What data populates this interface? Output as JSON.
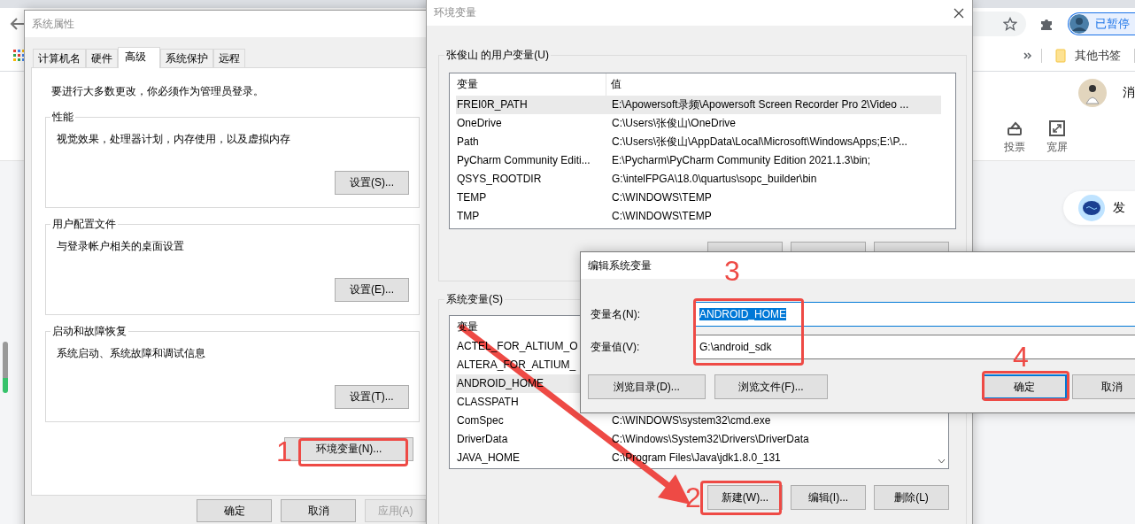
{
  "browser": {
    "profile_chip": "已暂停",
    "bookmark_folder": "其他书签",
    "user_menu": "消",
    "toolbar_actions": [
      {
        "label": "投票",
        "kind": "vote"
      },
      {
        "label": "宽屏",
        "kind": "widescreen"
      }
    ],
    "post_button": "发"
  },
  "system_properties": {
    "title": "系统属性",
    "tabs": [
      {
        "label": "计算机名",
        "selected": false
      },
      {
        "label": "硬件",
        "selected": false
      },
      {
        "label": "高级",
        "selected": true
      },
      {
        "label": "系统保护",
        "selected": false
      },
      {
        "label": "远程",
        "selected": false
      }
    ],
    "notice": "要进行大多数更改，你必须作为管理员登录。",
    "groups": [
      {
        "title": "性能",
        "description": "视觉效果，处理器计划，内存使用，以及虚拟内存",
        "button": "设置(S)..."
      },
      {
        "title": "用户配置文件",
        "description": "与登录帐户相关的桌面设置",
        "button": "设置(E)..."
      },
      {
        "title": "启动和故障恢复",
        "description": "系统启动、系统故障和调试信息",
        "button": "设置(T)..."
      }
    ],
    "env_button": "环境变量(N)...",
    "footer_buttons": [
      {
        "label": "确定",
        "disabled": false
      },
      {
        "label": "取消",
        "disabled": false
      },
      {
        "label": "应用(A)",
        "disabled": true
      }
    ]
  },
  "environment_variables": {
    "title": "环境变量",
    "user_group": {
      "title": "张俊山 的用户变量(U)",
      "columns": [
        "变量",
        "值"
      ],
      "rows": [
        {
          "name": "FREI0R_PATH",
          "value": "E:\\Apowersoft录频\\Apowersoft Screen Recorder Pro 2\\Video ...",
          "selected": true
        },
        {
          "name": "OneDrive",
          "value": "C:\\Users\\张俊山\\OneDrive",
          "selected": false
        },
        {
          "name": "Path",
          "value": "C:\\Users\\张俊山\\AppData\\Local\\Microsoft\\WindowsApps;E:\\P...",
          "selected": false
        },
        {
          "name": "PyCharm Community Editi...",
          "value": "E:\\Pycharm\\PyCharm Community Edition 2021.1.3\\bin;",
          "selected": false
        },
        {
          "name": "QSYS_ROOTDIR",
          "value": "G:\\intelFPGA\\18.0\\quartus\\sopc_builder\\bin",
          "selected": false
        },
        {
          "name": "TEMP",
          "value": "C:\\WINDOWS\\TEMP",
          "selected": false
        },
        {
          "name": "TMP",
          "value": "C:\\WINDOWS\\TEMP",
          "selected": false
        }
      ]
    },
    "system_group": {
      "title": "系统变量(S)",
      "columns": [
        "变量"
      ],
      "rows": [
        {
          "name": "ACTEL_FOR_ALTIUM_O",
          "selected": false
        },
        {
          "name": "ALTERA_FOR_ALTIUM_",
          "selected": false
        },
        {
          "name": "ANDROID_HOME",
          "selected": true
        },
        {
          "name": "CLASSPATH",
          "selected": false
        },
        {
          "name": "ComSpec",
          "value": "C:\\WINDOWS\\system32\\cmd.exe",
          "selected": false
        },
        {
          "name": "DriverData",
          "value": "C:\\Windows\\System32\\Drivers\\DriverData",
          "selected": false
        },
        {
          "name": "JAVA_HOME",
          "value": "C:\\Program Files\\Java\\jdk1.8.0_131",
          "selected": false
        }
      ],
      "buttons": [
        "新建(W)...",
        "编辑(I)...",
        "删除(L)"
      ]
    }
  },
  "edit_dialog": {
    "title": "编辑系统变量",
    "fields": [
      {
        "label": "变量名(N):",
        "value": "ANDROID_HOME",
        "text_selected": true
      },
      {
        "label": "变量值(V):",
        "value": "G:\\android_sdk",
        "text_selected": false
      }
    ],
    "buttons": [
      {
        "label": "浏览目录(D)...",
        "default": false
      },
      {
        "label": "浏览文件(F)...",
        "default": false
      },
      {
        "label": "确定",
        "default": true
      },
      {
        "label": "取消",
        "default": false
      }
    ]
  },
  "annotations": [
    {
      "kind": "step",
      "label": "1"
    },
    {
      "kind": "step",
      "label": "2"
    },
    {
      "kind": "step",
      "label": "3"
    },
    {
      "kind": "step",
      "label": "4"
    },
    {
      "kind": "arrow"
    }
  ]
}
